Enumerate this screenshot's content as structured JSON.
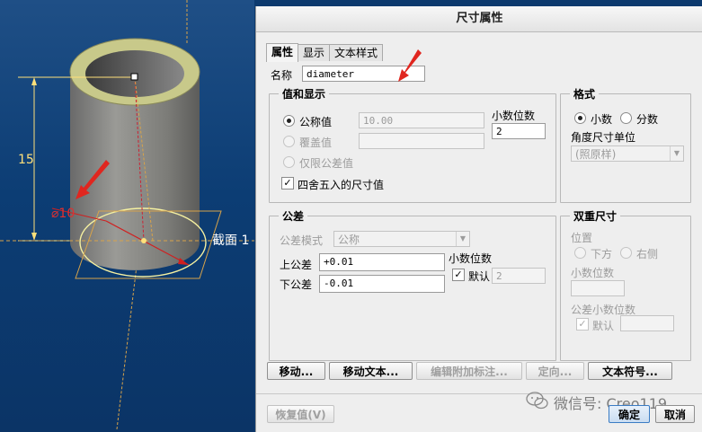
{
  "viewport": {
    "dim_height": "15",
    "dim_diameter": "⌀10",
    "section_label": "截面 1"
  },
  "dialog": {
    "title": "尺寸属性",
    "tabs": [
      "属性",
      "显示",
      "文本样式"
    ],
    "name_label": "名称",
    "name_value": "diameter",
    "values_group": {
      "title": "值和显示",
      "nominal_label": "公称值",
      "nominal_value": "10.00",
      "override_label": "覆盖值",
      "override_value": "",
      "tolerance_only_label": "仅限公差值",
      "decimals_label": "小数位数",
      "decimals_value": "2",
      "round_label": "四舍五入的尺寸值"
    },
    "format_group": {
      "title": "格式",
      "decimal_label": "小数",
      "fraction_label": "分数",
      "angle_unit_label": "角度尺寸单位",
      "angle_unit_value": "(照原样)"
    },
    "tolerance_group": {
      "title": "公差",
      "mode_label": "公差模式",
      "mode_value": "公称",
      "upper_label": "上公差",
      "upper_value": "+0.01",
      "lower_label": "下公差",
      "lower_value": "-0.01",
      "decimals_label": "小数位数",
      "default_label": "默认",
      "decimals_value": "2"
    },
    "dual_group": {
      "title": "双重尺寸",
      "position_label": "位置",
      "below_label": "下方",
      "right_label": "右侧",
      "decimals_label": "小数位数",
      "tol_decimals_label": "公差小数位数",
      "default_label": "默认"
    },
    "buttons": {
      "move": "移动...",
      "move_text": "移动文本...",
      "edit_attach": "编辑附加标注...",
      "orient": "定向...",
      "text_symbol": "文本符号...",
      "restore": "恢复值(V)",
      "ok": "确定",
      "cancel": "取消"
    }
  },
  "watermark": {
    "text": "微信号: Creo119"
  }
}
